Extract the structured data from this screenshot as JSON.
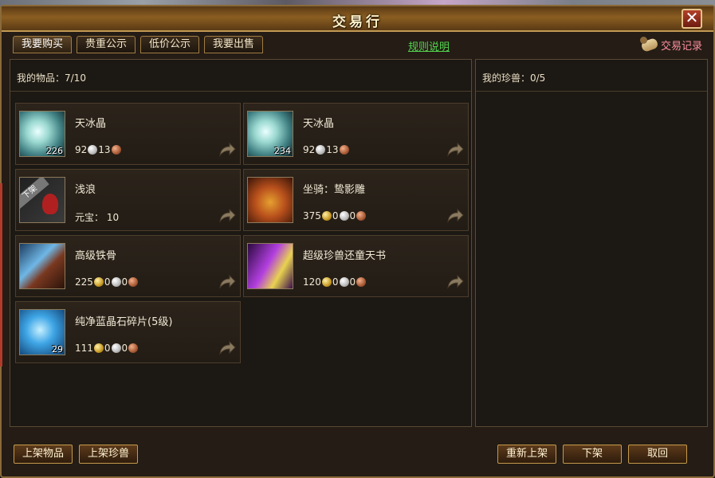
{
  "window": {
    "title": "交易行"
  },
  "tabs": [
    {
      "label": "我要购买"
    },
    {
      "label": "贵重公示"
    },
    {
      "label": "低价公示"
    },
    {
      "label": "我要出售"
    }
  ],
  "rules_link": "规则说明",
  "trade_record": "交易记录",
  "left_panel": {
    "header": "我的物品：7/10"
  },
  "right_panel": {
    "header": "我的珍兽：0/5"
  },
  "items": [
    {
      "name": "天冰晶",
      "count": "226",
      "icon": "ice-crystal-icon",
      "price": [
        {
          "amount": "92",
          "coin": "silver"
        },
        {
          "amount": "13",
          "coin": "copper"
        }
      ]
    },
    {
      "name": "天冰晶",
      "count": "234",
      "icon": "ice-crystal-icon",
      "price": [
        {
          "amount": "92",
          "coin": "silver"
        },
        {
          "amount": "13",
          "coin": "copper"
        }
      ]
    },
    {
      "name": "浅浪",
      "count": "",
      "icon": "removed-item-icon",
      "badge": "下架",
      "price_text": "元宝： 10"
    },
    {
      "name": "坐骑：鸷影雕",
      "count": "",
      "icon": "mount-eagle-icon",
      "price": [
        {
          "amount": "375",
          "coin": "gold"
        },
        {
          "amount": "0",
          "coin": "silver"
        },
        {
          "amount": "0",
          "coin": "copper"
        }
      ]
    },
    {
      "name": "高级铁骨",
      "count": "",
      "icon": "iron-bone-icon",
      "price": [
        {
          "amount": "225",
          "coin": "gold"
        },
        {
          "amount": "0",
          "coin": "silver"
        },
        {
          "amount": "0",
          "coin": "copper"
        }
      ]
    },
    {
      "name": "超级珍兽还童天书",
      "count": "",
      "icon": "pet-book-icon",
      "price": [
        {
          "amount": "120",
          "coin": "gold"
        },
        {
          "amount": "0",
          "coin": "silver"
        },
        {
          "amount": "0",
          "coin": "copper"
        }
      ]
    },
    {
      "name": "纯净蓝晶石碎片(5级)",
      "count": "29",
      "icon": "blue-crystal-shard-icon",
      "price": [
        {
          "amount": "111",
          "coin": "gold"
        },
        {
          "amount": "0",
          "coin": "silver"
        },
        {
          "amount": "0",
          "coin": "copper"
        }
      ]
    }
  ],
  "buttons": {
    "list_item": "上架物品",
    "list_pet": "上架珍兽",
    "relist": "重新上架",
    "delist": "下架",
    "cancel": "取回"
  },
  "colors": {
    "gold_coin": "#c89a24",
    "silver_coin": "#b9b9b9",
    "copper_coin": "#a85a36",
    "link_green": "#52d64e",
    "record_pink": "#ff8fa0"
  }
}
